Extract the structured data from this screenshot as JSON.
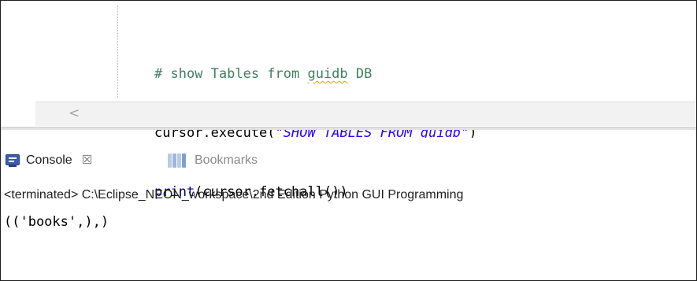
{
  "editor": {
    "lines": [
      "# show Tables from guidb DB",
      "cursor.execute(\"SHOW TABLES FROM guidb\")",
      "print(cursor.fetchall())"
    ],
    "line1": {
      "prefix": "# show Tables from ",
      "word": "guidb",
      "suffix": " DB"
    },
    "line2": {
      "call": "cursor.execute(",
      "quote_open": "\"",
      "str_text": "SHOW TABLES FROM ",
      "str_word": "guidb",
      "quote_close": "\"",
      "close": ")"
    },
    "line3": {
      "fn": "print",
      "rest": "(cursor.fetchall())"
    },
    "scroll_left_glyph": "<",
    "colors": {
      "comment": "#3f7f5f",
      "string": "#2a00ff",
      "builtin": "#000080",
      "spell_squiggle": "#e0a000"
    }
  },
  "console_view": {
    "tabs": [
      {
        "label": "Console",
        "icon": "console-icon",
        "active": true
      },
      {
        "label": "Bookmarks",
        "icon": "bookmarks-icon",
        "active": false
      }
    ],
    "close_glyph": "☒",
    "status_text": "<terminated> C:\\Eclipse_NEON_workspace\\2nd Edition Python GUI Programming",
    "output": "(('books',),)"
  }
}
